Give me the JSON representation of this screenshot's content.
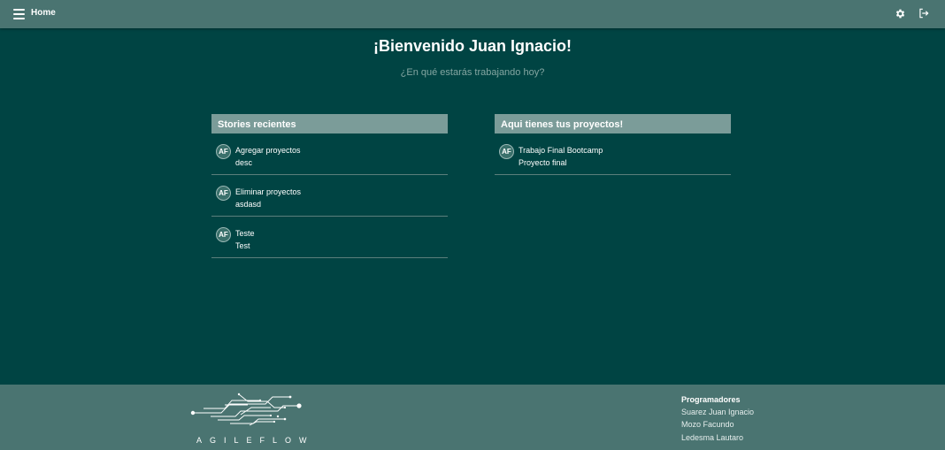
{
  "header": {
    "home_label": "Home",
    "icons": [
      "menu-icon",
      "gear-icon",
      "logout-icon"
    ]
  },
  "welcome": {
    "title": "¡Bienvenido Juan Ignacio!",
    "subtitle": "¿En qué estarás trabajando hoy?"
  },
  "stories": {
    "heading": "Stories recientes",
    "items": [
      {
        "avatar": "AF",
        "title": "Agregar proyectos",
        "desc": "desc"
      },
      {
        "avatar": "AF",
        "title": "Eliminar proyectos",
        "desc": "asdasd"
      },
      {
        "avatar": "AF",
        "title": "Teste",
        "desc": "Test"
      }
    ]
  },
  "projects": {
    "heading": "Aqui tienes tus proyectos!",
    "items": [
      {
        "avatar": "AF",
        "title": "Trabajo Final Bootcamp",
        "desc": "Proyecto final"
      }
    ]
  },
  "footer": {
    "brand": "AGILEFLOW",
    "developers_heading": "Programadores",
    "developers": [
      "Suarez Juan Ignacio",
      "Mozo Facundo",
      "Ledesma Lautaro"
    ]
  },
  "colors": {
    "background": "#004443",
    "bar": "#4a7471",
    "panel_header": "#7b9c99",
    "subtitle": "#84a6a2"
  }
}
